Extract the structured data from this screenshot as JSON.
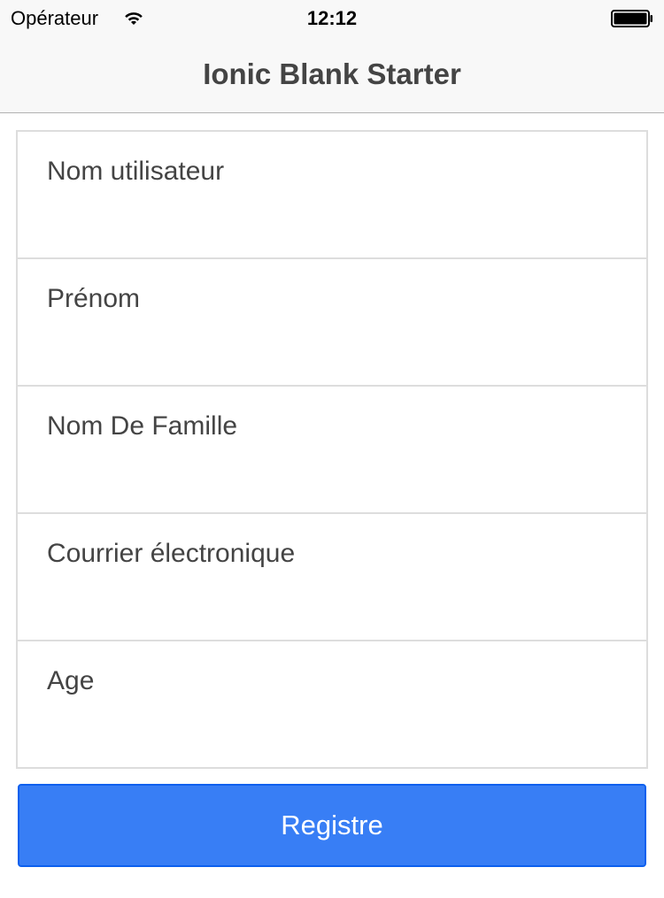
{
  "status_bar": {
    "carrier": "Opérateur",
    "time": "12:12"
  },
  "header": {
    "title": "Ionic Blank Starter"
  },
  "form": {
    "fields": [
      {
        "label": "Nom utilisateur"
      },
      {
        "label": "Prénom"
      },
      {
        "label": "Nom De Famille"
      },
      {
        "label": "Courrier électronique"
      },
      {
        "label": "Age"
      }
    ],
    "submit_label": "Registre"
  },
  "colors": {
    "button_bg": "#387ef5",
    "button_border": "#0c60ee",
    "header_bg": "#f8f8f8",
    "label_text": "#444444"
  },
  "icons": {
    "wifi": "wifi-icon",
    "battery": "battery-icon"
  }
}
